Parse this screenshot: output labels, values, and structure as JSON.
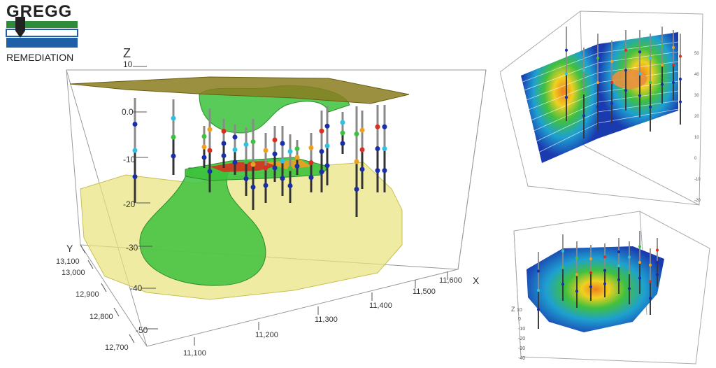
{
  "logo": {
    "name": "GREGG",
    "tagline": "REMEDIATION",
    "colors": {
      "green": "#2e8b3a",
      "blue": "#1f5fa8",
      "dark": "#222222"
    }
  },
  "main_view": {
    "z_axis": {
      "label": "Z",
      "ticks": [
        "10",
        "0.0",
        "-10",
        "-20",
        "-30",
        "-40",
        "-50"
      ]
    },
    "y_axis": {
      "label": "Y",
      "ticks": [
        "13,100",
        "13,000",
        "12,900",
        "12,800",
        "12,700"
      ]
    },
    "x_axis": {
      "label": "X",
      "ticks": [
        "11,100",
        "11,200",
        "11,300",
        "11,400",
        "11,500",
        "11,600"
      ]
    }
  },
  "top_right_view": {
    "y_ticks": [
      "-20",
      "-10",
      "0",
      "10",
      "20",
      "30",
      "40",
      "50"
    ]
  },
  "bottom_right_view": {
    "z_label": "Z",
    "z_ticks": [
      "10",
      "0",
      "-10",
      "-20",
      "-30",
      "-40"
    ]
  },
  "colors": {
    "yellow_volume": "#e8e27a",
    "green_plume": "#3cc23c",
    "olive_surface": "#8a7d1e",
    "well_blue": "#1a2ea8",
    "hot_red": "#d8301e",
    "hot_orange": "#f0a020"
  }
}
